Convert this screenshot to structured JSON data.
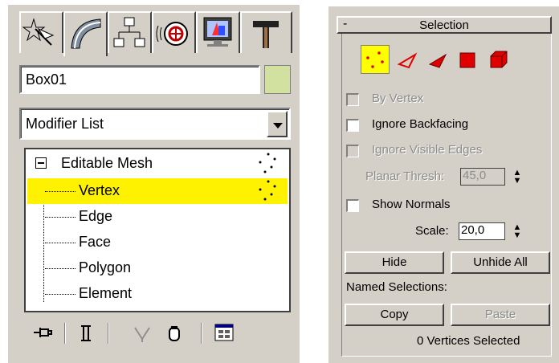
{
  "left_panel": {
    "tabs": [
      {
        "icon": "create-star-icon"
      },
      {
        "icon": "modify-curve-icon"
      },
      {
        "icon": "hierarchy-icon"
      },
      {
        "icon": "motion-icon"
      },
      {
        "icon": "display-monitor-icon"
      },
      {
        "icon": "utilities-hammer-icon"
      }
    ],
    "object_name": "Box01",
    "object_color": "#d2e0a0",
    "modifier_list": "Modifier List",
    "stack": {
      "root": "Editable Mesh",
      "items": [
        "Vertex",
        "Edge",
        "Face",
        "Polygon",
        "Element"
      ],
      "selected": "Vertex",
      "highlight_color": "#fff200"
    },
    "bottom_tools": [
      "pin-stack-icon",
      "show-end-result-icon",
      "make-unique-icon",
      "remove-modifier-icon",
      "configure-modifier-sets-icon"
    ]
  },
  "selection_rollout": {
    "minus": "-",
    "title": "Selection",
    "subobject_buttons": [
      "vertex-icon",
      "edge-icon",
      "face-icon",
      "polygon-icon",
      "element-icon"
    ],
    "by_vertex": "By Vertex",
    "ignore_backfacing": "Ignore Backfacing",
    "ignore_visible_edges": "Ignore Visible Edges",
    "planar_thresh_label": "Planar Thresh:",
    "planar_thresh_value": "45,0",
    "show_normals": "Show Normals",
    "scale_label": "Scale:",
    "scale_value": "20,0",
    "hide": "Hide",
    "unhide_all": "Unhide All",
    "named_selections": "Named Selections:",
    "copy": "Copy",
    "paste": "Paste",
    "status": "0 Vertices Selected"
  }
}
